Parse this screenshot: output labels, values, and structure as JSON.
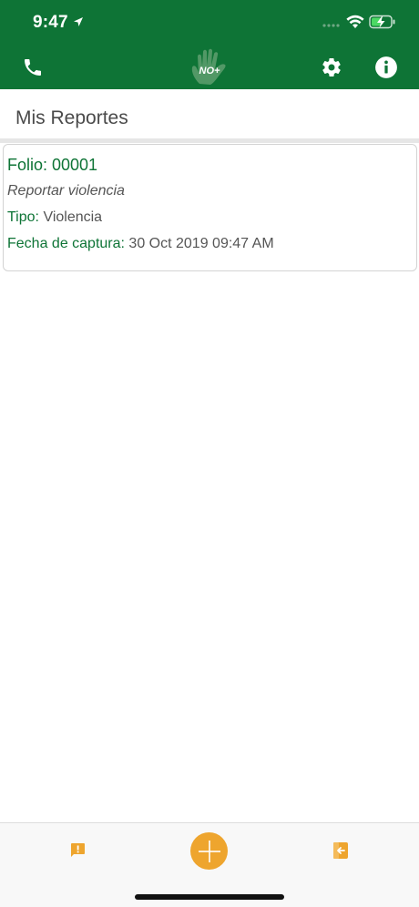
{
  "status_bar": {
    "time": "9:47"
  },
  "nav": {
    "logo_text": "NO+"
  },
  "page": {
    "title": "Mis Reportes"
  },
  "reports": [
    {
      "folio": "Folio: 00001",
      "description": "Reportar violencia",
      "type_label": "Tipo:",
      "type_value": "Violencia",
      "date_label": "Fecha de captura:",
      "date_value": "30 Oct 2019 09:47 AM"
    }
  ],
  "colors": {
    "header_green": "#0e7436",
    "accent_orange": "#eea52e",
    "label_green": "#0e7436"
  },
  "icons": {
    "nav_left": "phone-icon",
    "nav_right_1": "gear-icon",
    "nav_right_2": "info-icon",
    "tab_left": "report-alert-icon",
    "tab_center": "plus-icon",
    "tab_right": "logout-icon"
  }
}
